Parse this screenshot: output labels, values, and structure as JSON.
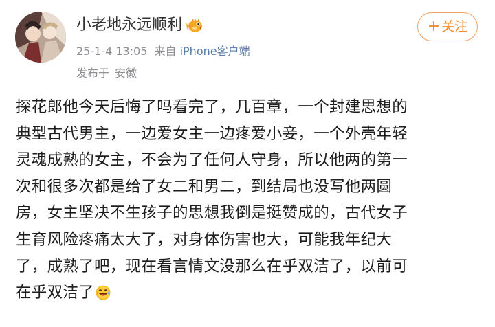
{
  "user": {
    "name": "小老地永远顺利",
    "badge_icon": "pufferfish-icon"
  },
  "meta": {
    "timestamp": "25-1-4 13:05",
    "from_label": "来自",
    "source": "iPhone客户端",
    "location_label": "发布于",
    "location": "安徽"
  },
  "follow_button": {
    "label": "关注"
  },
  "post": {
    "lines": [
      "探花郎他今天后悔了吗看完了，几百章，一个封建思想的",
      "典型古代男主，一边爱女主一边疼爱小妾，一个外壳年轻",
      "灵魂成熟的女主，不会为了任何人守身，所以他两的第一",
      "次和很多次都是给了女二和男二，到结局也没写他两圆",
      "房，女主坚决不生孩子的思想我倒是挺赞成的，古代女子",
      "生育风险疼痛太大了，对身体伤害也大，可能我年纪大",
      "了，成熟了吧，现在看言情文没那么在乎双洁了，以前可",
      "在乎双洁了"
    ],
    "trailing_emoji": "laughing-tears-icon"
  },
  "colors": {
    "accent": "#f08a2c",
    "link": "#5b7da8",
    "meta": "#8e8e93"
  }
}
